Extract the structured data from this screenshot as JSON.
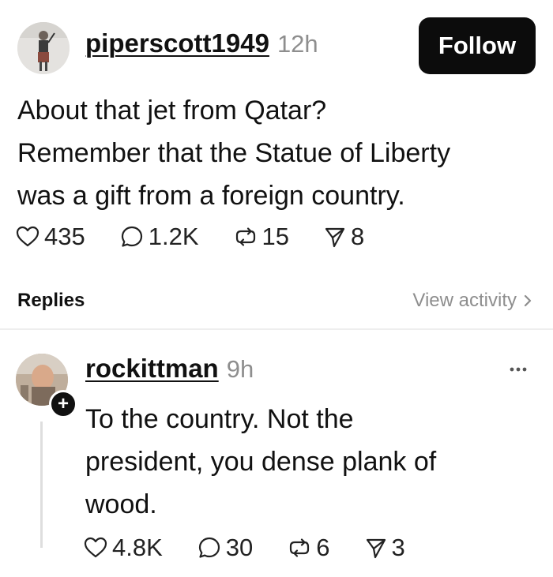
{
  "post": {
    "username": "piperscott1949",
    "time": "12h",
    "follow_label": "Follow",
    "text_lines": [
      "About that jet from Qatar?",
      "Remember that the Statue of Liberty",
      "was a gift from a foreign country."
    ],
    "stats": {
      "likes": "435",
      "replies": "1.2K",
      "reposts": "15",
      "shares": "8"
    }
  },
  "replies_section": {
    "label": "Replies",
    "view_activity": "View activity"
  },
  "reply": {
    "username": "rockittman",
    "time": "9h",
    "badge": "+",
    "text_lines": [
      "To the country. Not the",
      "president, you dense plank of",
      "wood."
    ],
    "stats": {
      "likes": "4.8K",
      "replies": "30",
      "reposts": "6",
      "shares": "3"
    }
  },
  "icons": {
    "like": "heart-icon",
    "reply": "comment-icon",
    "repost": "repost-icon",
    "share": "send-icon",
    "more": "more-dots-icon",
    "chevron": "chevron-right-icon"
  },
  "colors": {
    "text": "#111111",
    "muted": "#8e8e8e",
    "button": "#0c0c0c",
    "divider": "#eeeeee"
  }
}
